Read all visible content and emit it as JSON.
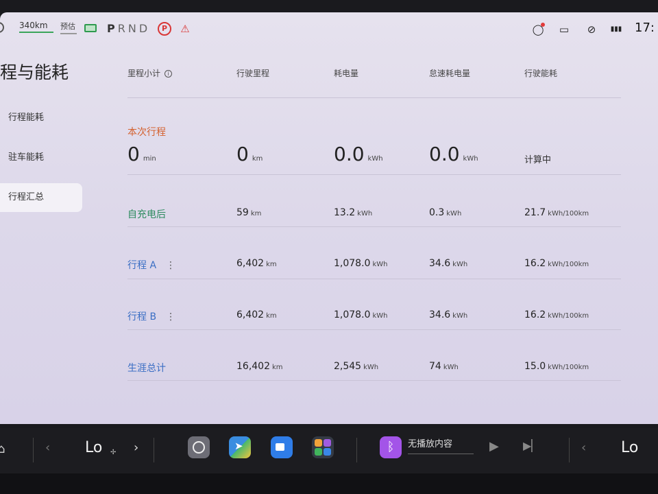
{
  "status_bar": {
    "range": "340km",
    "estimate": "预估",
    "gear": [
      "P",
      "R",
      "N",
      "D"
    ],
    "park_label": "P",
    "time": "17:"
  },
  "sidebar": {
    "title": "程与能耗",
    "items": [
      {
        "label": "行程能耗"
      },
      {
        "label": "驻车能耗"
      },
      {
        "label": "行程汇总"
      }
    ]
  },
  "table": {
    "headers": [
      "里程小计",
      "行驶里程",
      "耗电量",
      "怠速耗电量",
      "行驶能耗"
    ],
    "current_trip": {
      "label": "本次行程",
      "duration": "0",
      "duration_unit": "min",
      "distance": "0",
      "distance_unit": "km",
      "energy": "0.0",
      "energy_unit": "kWh",
      "idle_energy": "0.0",
      "idle_energy_unit": "kWh",
      "consumption": "计算中"
    },
    "rows": [
      {
        "label": "自充电后",
        "distance": "59",
        "distance_unit": "km",
        "energy": "13.2",
        "energy_unit": "kWh",
        "idle": "0.3",
        "idle_unit": "kWh",
        "consumption": "21.7",
        "consumption_unit": "kWh/100km"
      },
      {
        "label": "行程 A",
        "distance": "6,402",
        "distance_unit": "km",
        "energy": "1,078.0",
        "energy_unit": "kWh",
        "idle": "34.6",
        "idle_unit": "kWh",
        "consumption": "16.2",
        "consumption_unit": "kWh/100km"
      },
      {
        "label": "行程 B",
        "distance": "6,402",
        "distance_unit": "km",
        "energy": "1,078.0",
        "energy_unit": "kWh",
        "idle": "34.6",
        "idle_unit": "kWh",
        "consumption": "16.2",
        "consumption_unit": "kWh/100km"
      },
      {
        "label": "生涯总计",
        "distance": "16,402",
        "distance_unit": "km",
        "energy": "2,545",
        "energy_unit": "kWh",
        "idle": "74",
        "idle_unit": "kWh",
        "consumption": "15.0",
        "consumption_unit": "kWh/100km"
      }
    ]
  },
  "dock": {
    "climate_left": "Lo",
    "climate_right": "Lo",
    "media_status": "无播放内容"
  },
  "colors": {
    "accent_orange": "#d4612f",
    "accent_green": "#2d8b5f",
    "accent_blue": "#3a6ec4",
    "bluetooth": "#a354e8"
  }
}
